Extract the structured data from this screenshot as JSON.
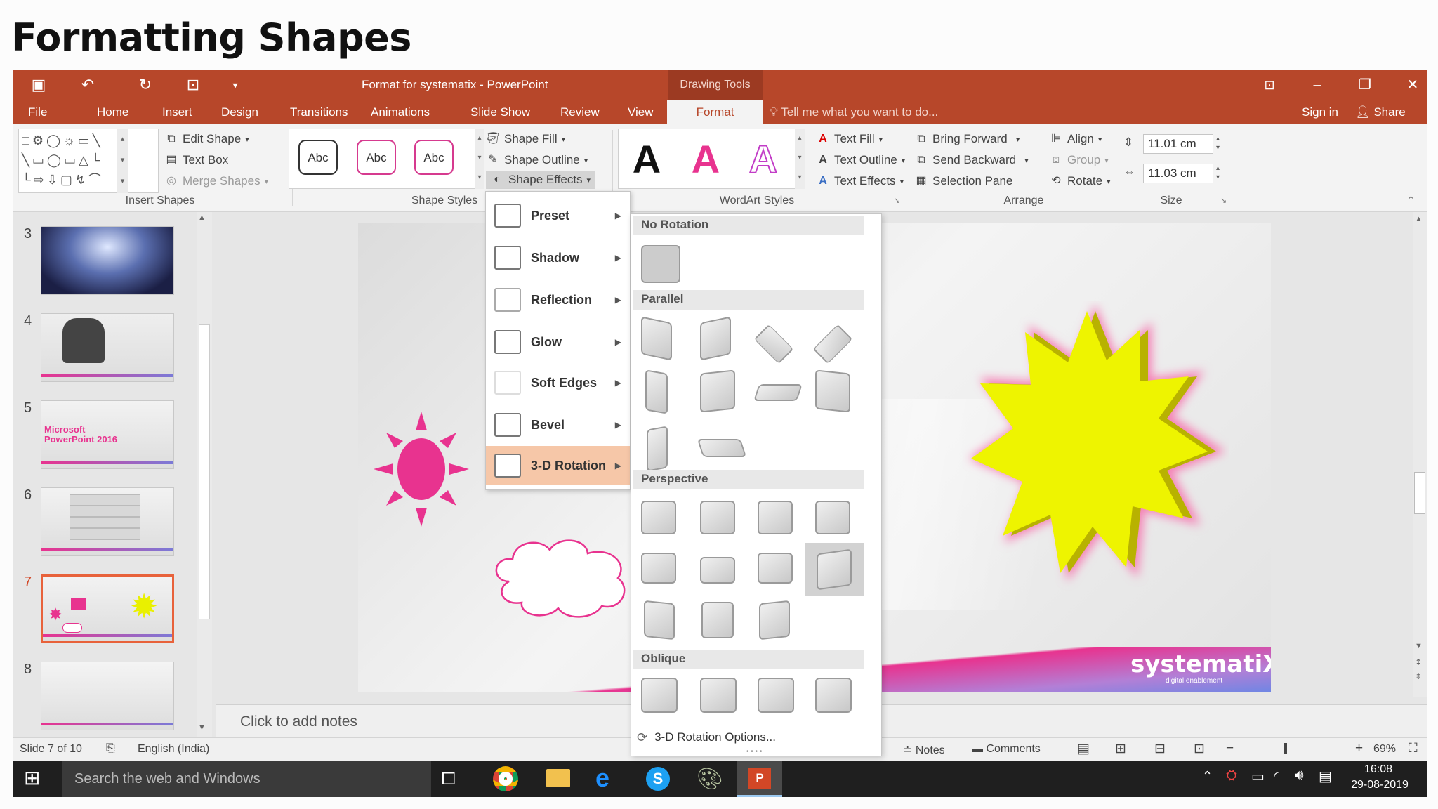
{
  "page_title": "Formatting Shapes",
  "window": {
    "title": "Format for systematix - PowerPoint",
    "contextual_tab": "Drawing Tools",
    "sign_in": "Sign in",
    "share": "Share"
  },
  "tabs": [
    "File",
    "Home",
    "Insert",
    "Design",
    "Transitions",
    "Animations",
    "Slide Show",
    "Review",
    "View",
    "Format"
  ],
  "active_tab": "Format",
  "tell_me": "Tell me what you want to do...",
  "ribbon": {
    "insert_shapes": {
      "label": "Insert Shapes",
      "edit_shape": "Edit Shape",
      "text_box": "Text Box",
      "merge_shapes": "Merge Shapes"
    },
    "shape_styles": {
      "label": "Shape Styles",
      "swatches": [
        "Abc",
        "Abc",
        "Abc"
      ],
      "fill": "Shape Fill",
      "outline": "Shape Outline",
      "effects": "Shape Effects"
    },
    "wordart": {
      "label": "WordArt Styles",
      "letter": "A",
      "text_fill": "Text Fill",
      "text_outline": "Text Outline",
      "text_effects": "Text Effects"
    },
    "arrange": {
      "label": "Arrange",
      "bring_forward": "Bring Forward",
      "send_backward": "Send Backward",
      "selection_pane": "Selection Pane",
      "align": "Align",
      "group": "Group",
      "rotate": "Rotate"
    },
    "size": {
      "label": "Size",
      "height": "11.01 cm",
      "width": "11.03 cm"
    }
  },
  "shape_effects_menu": {
    "items": [
      "Preset",
      "Shadow",
      "Reflection",
      "Glow",
      "Soft Edges",
      "Bevel",
      "3-D Rotation"
    ],
    "active": "3-D Rotation"
  },
  "rotation_gallery": {
    "sections": [
      {
        "title": "No Rotation",
        "count": 1
      },
      {
        "title": "Parallel",
        "count": 10
      },
      {
        "title": "Perspective",
        "count": 11
      },
      {
        "title": "Oblique",
        "count": 4
      }
    ],
    "options_label": "3-D Rotation Options..."
  },
  "thumbnails": [
    {
      "num": "3",
      "kind": "stage"
    },
    {
      "num": "4",
      "kind": "people"
    },
    {
      "num": "5",
      "kind": "title",
      "text": "Microsoft PowerPoint 2016"
    },
    {
      "num": "6",
      "kind": "table"
    },
    {
      "num": "7",
      "kind": "shapes",
      "active": true
    },
    {
      "num": "8",
      "kind": "blank"
    }
  ],
  "slide": {
    "logo": "systematiX",
    "tagline": "digital enablement"
  },
  "notes_placeholder": "Click to add notes",
  "status": {
    "slide_info": "Slide 7 of 10",
    "language": "English (India)",
    "notes": "Notes",
    "comments": "Comments",
    "zoom": "69%"
  },
  "taskbar": {
    "search": "Search the web and Windows",
    "time": "16:08",
    "date": "29-08-2019"
  },
  "colors": {
    "accent": "#b7472a",
    "pink": "#e8338f",
    "yellow": "#e9f000",
    "menu_highlight": "#f6c7a8"
  }
}
